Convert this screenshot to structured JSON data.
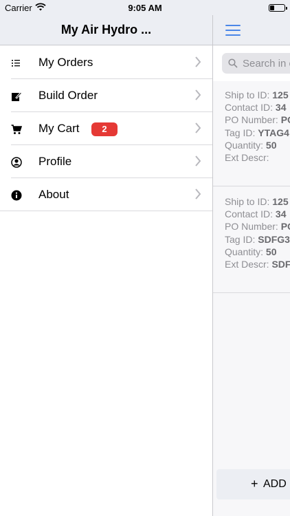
{
  "status": {
    "carrier": "Carrier",
    "time": "9:05 AM"
  },
  "drawer": {
    "title": "My Air Hydro ...",
    "items": [
      {
        "label": "My Orders",
        "icon": "list-icon"
      },
      {
        "label": "Build Order",
        "icon": "edit-icon"
      },
      {
        "label": "My Cart",
        "icon": "cart-icon",
        "badge": "2"
      },
      {
        "label": "Profile",
        "icon": "person-icon"
      },
      {
        "label": "About",
        "icon": "info-icon"
      }
    ]
  },
  "content": {
    "search_placeholder": "Search in o",
    "orders": [
      {
        "ship_label": "Ship to ID: ",
        "ship_value": "125",
        "contact_label": "Contact ID: ",
        "contact_value": "34",
        "po_label": "PO Number: ",
        "po_value": "PO",
        "tag_label": "Tag ID: ",
        "tag_value": "YTAG4",
        "qty_label": "Quantity: ",
        "qty_value": "50",
        "ext_label": "Ext Descr:",
        "ext_value": ""
      },
      {
        "ship_label": "Ship to ID: ",
        "ship_value": "125",
        "contact_label": "Contact ID: ",
        "contact_value": "34",
        "po_label": "PO Number: ",
        "po_value": "PO",
        "tag_label": "Tag ID: ",
        "tag_value": "SDFG3",
        "qty_label": "Quantity: ",
        "qty_value": "50",
        "ext_label": "Ext Descr: ",
        "ext_value": "SDF"
      }
    ],
    "add_button": "ADD I"
  },
  "colors": {
    "accent": "#4a86e8",
    "badge": "#e53935",
    "header_bg": "#eceef3"
  }
}
